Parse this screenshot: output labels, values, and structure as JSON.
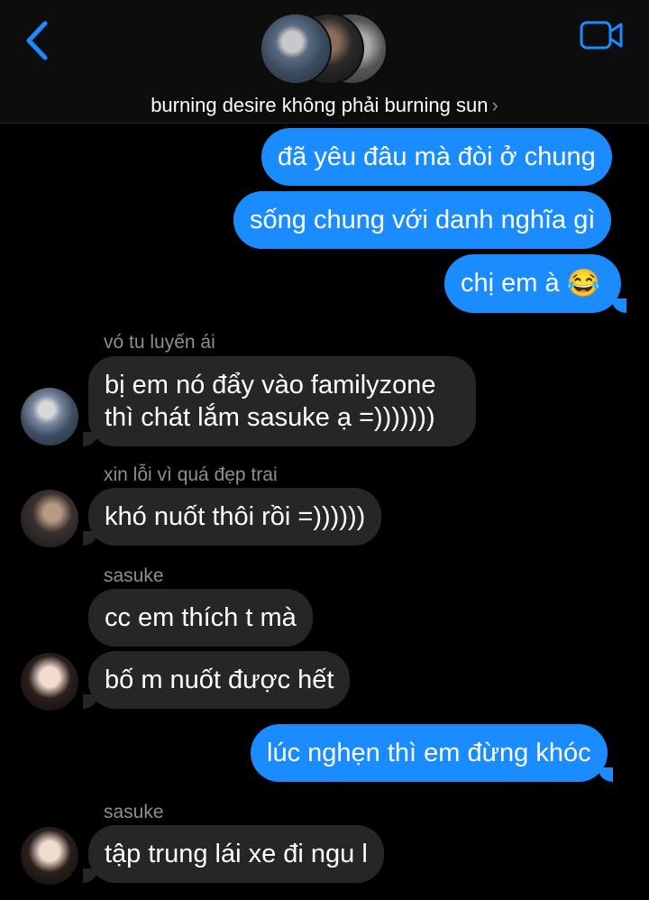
{
  "header": {
    "group_name": "burning desire không phải burning sun",
    "chevron": "›",
    "icons": {
      "back": "chevron-left-icon",
      "video": "video-camera-icon"
    },
    "accent": "#1a8cff"
  },
  "messages": [
    {
      "dir": "out",
      "text": "đã yêu đâu mà đòi ở chung"
    },
    {
      "dir": "out",
      "text": "sống chung với danh nghĩa gì"
    },
    {
      "dir": "out",
      "text": "chị em à",
      "emoji": "😂"
    },
    {
      "dir": "in",
      "sender": "vó tu luyến ái",
      "lines": [
        "bị em nó đẩy vào familyzone",
        "thì chát lắm sasuke ạ =)))))))"
      ]
    },
    {
      "dir": "in",
      "sender": "xin lỗi vì quá đẹp trai",
      "text": "khó nuốt thôi rồi =))))))"
    },
    {
      "dir": "in",
      "sender": "sasuke",
      "text": "cc em thích t mà"
    },
    {
      "dir": "in",
      "text": "bố m nuốt được hết"
    },
    {
      "dir": "out",
      "text": "lúc nghẹn thì em đừng khóc"
    },
    {
      "dir": "in",
      "sender": "sasuke",
      "text": "tập trung lái xe đi ngu l"
    }
  ],
  "colors": {
    "outgoing_bubble": "#1a8cff",
    "incoming_bubble": "#262628",
    "background": "#000000",
    "sender_text": "#8e8e93"
  }
}
